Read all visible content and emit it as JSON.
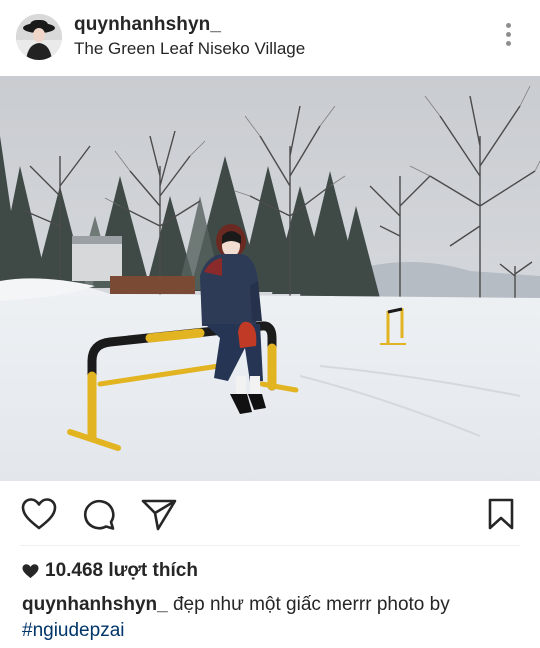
{
  "post": {
    "username": "quynhanhshyn_",
    "location": "The Green Leaf Niseko Village",
    "likes_text": "10.468 lượt thích",
    "caption_user": "quynhanhshyn_",
    "caption_text": " đẹp như một giấc merrr photo by",
    "hashtag": "#ngiudepzai"
  },
  "icons": {
    "more": "more-vertical-icon",
    "like": "heart-outline-icon",
    "comment": "comment-bubble-icon",
    "share": "paper-plane-icon",
    "save": "bookmark-icon",
    "likes_heart": "heart-filled-icon"
  },
  "colors": {
    "text": "#262626",
    "muted": "#8e8e8e",
    "hashtag": "#003569",
    "snow": "#e9edf1",
    "bar_yellow": "#e2b422",
    "bar_black": "#1b1b1b"
  }
}
